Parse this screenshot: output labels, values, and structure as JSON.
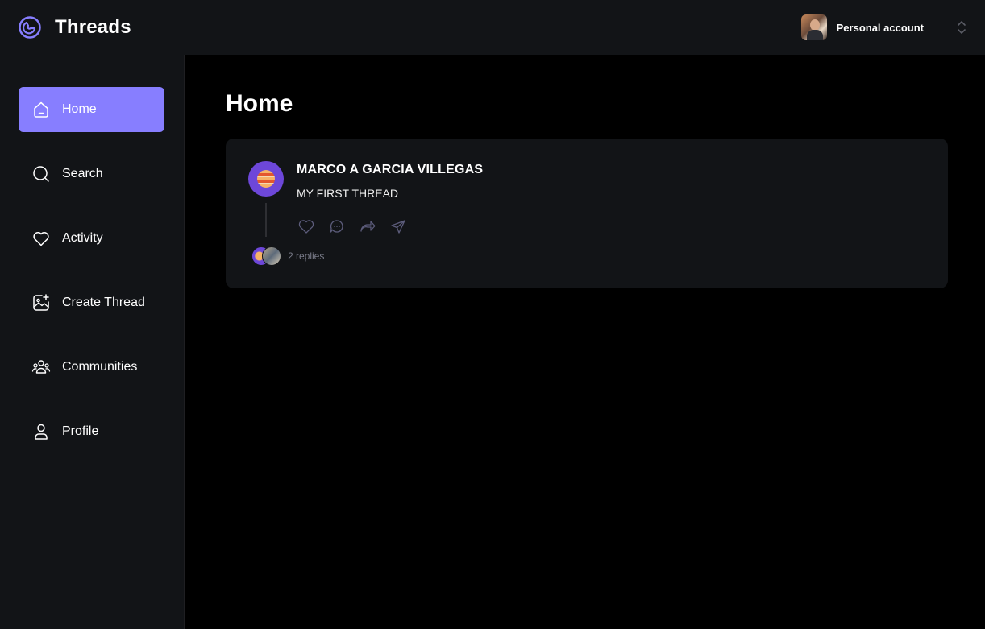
{
  "header": {
    "brand_name": "Threads",
    "account_label": "Personal account"
  },
  "sidebar": {
    "items": [
      {
        "label": "Home",
        "icon": "home-icon",
        "active": true
      },
      {
        "label": "Search",
        "icon": "search-icon",
        "active": false
      },
      {
        "label": "Activity",
        "icon": "heart-icon",
        "active": false
      },
      {
        "label": "Create Thread",
        "icon": "create-thread-icon",
        "active": false
      },
      {
        "label": "Communities",
        "icon": "communities-icon",
        "active": false
      },
      {
        "label": "Profile",
        "icon": "user-icon",
        "active": false
      }
    ]
  },
  "main": {
    "page_title": "Home",
    "threads": [
      {
        "author": "MARCO A GARCIA VILLEGAS",
        "text": "MY FIRST THREAD",
        "replies": "2 replies"
      }
    ]
  },
  "colors": {
    "accent": "#877eff",
    "surface": "#121417",
    "background": "#000000",
    "muted_text": "#7a7c8a"
  }
}
